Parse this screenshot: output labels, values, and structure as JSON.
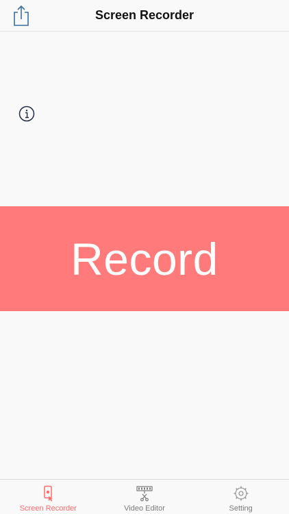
{
  "navbar": {
    "title": "Screen Recorder"
  },
  "main": {
    "record_label": "Record"
  },
  "tabbar": {
    "tabs": [
      {
        "label": "Screen Recorder",
        "icon": "phone-record-icon",
        "active": true
      },
      {
        "label": "Video Editor",
        "icon": "film-scissors-icon",
        "active": false
      },
      {
        "label": "Setting",
        "icon": "gear-icon",
        "active": false
      }
    ]
  },
  "colors": {
    "accent": "#ff6b6b",
    "record_band": "#ff7b7b",
    "background": "#f9f9f9",
    "inactive": "#7a7a7a"
  }
}
